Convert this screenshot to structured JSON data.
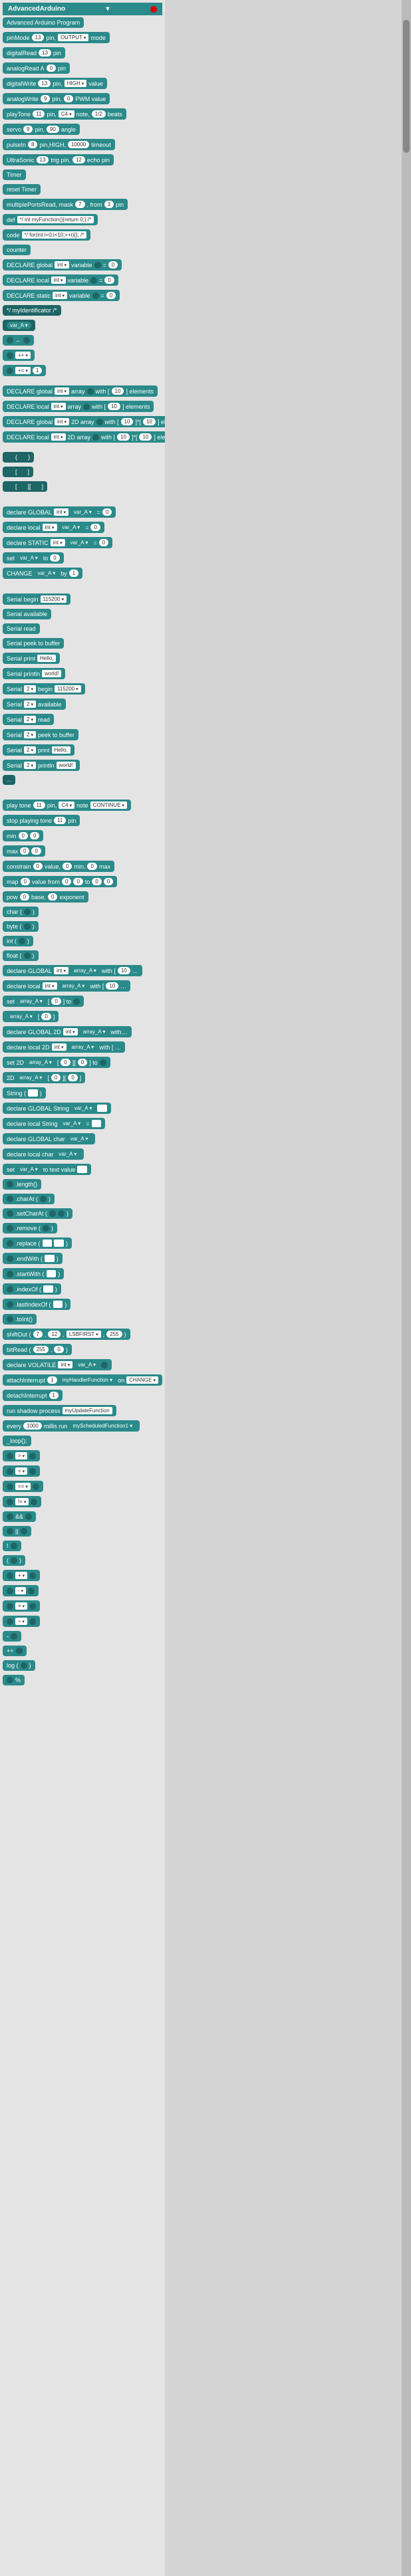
{
  "header": "AdvancedArduino",
  "blocks": [
    {
      "t": "Advanced Arduino Program"
    },
    {
      "parts": [
        "pinMode ",
        {
          "pill": "13"
        },
        " pin, ",
        {
          "drop": "OUTPUT"
        },
        " mode"
      ]
    },
    {
      "parts": [
        "digitalRead ",
        {
          "pill": "13"
        },
        " pin"
      ]
    },
    {
      "parts": [
        "analogRead A ",
        {
          "pill": "0"
        },
        " pin"
      ]
    },
    {
      "parts": [
        "digitalWrite ",
        {
          "pill": "13"
        },
        " pin, ",
        {
          "drop": "HIGH"
        },
        " value"
      ]
    },
    {
      "parts": [
        "analogWrite ",
        {
          "pill": "9"
        },
        " pin, ",
        {
          "pill": "0"
        },
        " PWM value"
      ]
    },
    {
      "parts": [
        "playTone ",
        {
          "pill": "11"
        },
        " pin, ",
        {
          "drop": "C4"
        },
        " note, ",
        {
          "pill": "1/2"
        },
        " beats"
      ]
    },
    {
      "parts": [
        "servo ",
        {
          "pill": "9"
        },
        " pin, ",
        {
          "pill": "90"
        },
        " angle"
      ]
    },
    {
      "parts": [
        "pulseIn ",
        {
          "pill": "8"
        },
        " pin,HIGH, ",
        {
          "pill": "10000"
        },
        " timeout"
      ]
    },
    {
      "parts": [
        "UltraSonic ",
        {
          "pill": "13"
        },
        " trig pin, ",
        {
          "pill": "12"
        },
        " echo pin"
      ]
    },
    {
      "t": "Timer"
    },
    {
      "t": "reset Timer"
    },
    {
      "parts": [
        "multiplePortsRead, mask ",
        {
          "pill": "7"
        },
        ", from ",
        {
          "pill": "3"
        },
        " pin"
      ]
    },
    {
      "parts": [
        "def ",
        {
          "rect": "*/ int myFunction(){return 0;} /*"
        }
      ]
    },
    {
      "parts": [
        "code ",
        {
          "rect": "*/ for(int i=0;i<10;++i){}; /*"
        }
      ]
    },
    {
      "t": "counter"
    },
    {
      "parts": [
        "DECLARE global ",
        {
          "drop": "int"
        },
        " variable ",
        {
          "hole": true
        },
        " = ",
        {
          "pill": "0"
        }
      ]
    },
    {
      "parts": [
        "DECLARE local ",
        {
          "drop": "int"
        },
        " variable ",
        {
          "hole": true
        },
        " = ",
        {
          "pill": "0"
        }
      ]
    },
    {
      "parts": [
        "DECLARE static ",
        {
          "drop": "int"
        },
        " variable ",
        {
          "hole": true
        },
        " = ",
        {
          "pill": "0"
        }
      ]
    },
    {
      "t": "*/ myIdentificator /*",
      "cls": "dark"
    },
    {
      "parts": [
        {
          "pilltg": "var_A"
        }
      ],
      "cls": "dark"
    },
    {
      "parts": [
        {
          "hole": true
        },
        " ← ",
        {
          "holerr": true
        }
      ]
    },
    {
      "parts": [
        {
          "hole": true
        },
        {
          "drop": "++"
        }
      ]
    },
    {
      "parts": [
        {
          "hole": true
        },
        {
          "drop": "+="
        },
        {
          "pill": "1"
        }
      ]
    },
    "sep",
    {
      "parts": [
        "DECLARE global ",
        {
          "drop": "int"
        },
        " array ",
        {
          "hole": true
        },
        " with [ ",
        {
          "pill": "10"
        },
        " ] elements"
      ]
    },
    {
      "parts": [
        "DECLARE local ",
        {
          "drop": "int"
        },
        " array ",
        {
          "hole": true
        },
        " with [ ",
        {
          "pill": "10"
        },
        " ] elements"
      ]
    },
    {
      "parts": [
        "DECLARE global ",
        {
          "drop": "int"
        },
        " 2D array ",
        {
          "hole": true
        },
        " with [ ",
        {
          "pill": "10"
        },
        " ]*[ ",
        {
          "pill": "10"
        },
        " ] elements"
      ]
    },
    {
      "parts": [
        "DECLARE local ",
        {
          "drop": "int"
        },
        " 2D array ",
        {
          "hole": true
        },
        " with [ ",
        {
          "pill": "10"
        },
        " ]*[ ",
        {
          "pill": "10"
        },
        " ] elements"
      ]
    },
    "sep",
    {
      "parts": [
        {
          "hole": true
        },
        " (",
        {
          "holerr": true
        },
        ") "
      ],
      "cls": "dark"
    },
    {
      "parts": [
        {
          "hole": true
        },
        " [",
        {
          "holerr": true
        },
        "] "
      ],
      "cls": "dark"
    },
    {
      "parts": [
        {
          "hole": true
        },
        " [",
        {
          "holerr": true
        },
        "][",
        {
          "holerr": true
        },
        "] "
      ],
      "cls": "dark"
    },
    "sep2",
    {
      "parts": [
        "declare GLOBAL ",
        {
          "drop": "int"
        },
        {
          "pilltg": "var_A"
        },
        " = ",
        {
          "pill": "0"
        }
      ]
    },
    {
      "parts": [
        "declare local ",
        {
          "drop": "int"
        },
        {
          "pilltg": "var_A"
        },
        " = ",
        {
          "pill": "0"
        }
      ]
    },
    {
      "parts": [
        "declare STATIC ",
        {
          "drop": "int"
        },
        {
          "pilltg": "var_A"
        },
        " = ",
        {
          "pill": "0"
        }
      ]
    },
    {
      "parts": [
        "set ",
        {
          "pilltg": "var_A"
        },
        " to ",
        {
          "pill": "0"
        }
      ]
    },
    {
      "parts": [
        "CHANGE ",
        {
          "pilltg": "var_A"
        },
        " by ",
        {
          "pill": "1"
        }
      ]
    },
    "sep2",
    {
      "parts": [
        "Serial begin ",
        {
          "drop": "115200"
        }
      ]
    },
    {
      "t": "Serial available"
    },
    {
      "t": "Serial read"
    },
    {
      "t": "Serial peek to buffer"
    },
    {
      "parts": [
        "Serial print ",
        {
          "rect": "Hello,"
        }
      ]
    },
    {
      "parts": [
        "Serial println ",
        {
          "rect": "world!"
        }
      ]
    },
    {
      "parts": [
        "Serial ",
        {
          "drop": "2"
        },
        " begin ",
        {
          "drop": "115200"
        }
      ]
    },
    {
      "parts": [
        "Serial ",
        {
          "drop": "2"
        },
        " available"
      ]
    },
    {
      "parts": [
        "Serial ",
        {
          "drop": "2"
        },
        " read"
      ]
    },
    {
      "parts": [
        "Serial ",
        {
          "drop": "2"
        },
        " peek to buffer"
      ]
    },
    {
      "parts": [
        "Serial ",
        {
          "drop": "2"
        },
        " print ",
        {
          "rect": "Hello,"
        }
      ]
    },
    {
      "parts": [
        "Serial ",
        {
          "drop": "2"
        },
        " println ",
        {
          "rect": "world!"
        }
      ]
    },
    {
      "t": "...",
      "cls": "dark small"
    },
    "sep2",
    {
      "parts": [
        "play tone ",
        {
          "pill": "11"
        },
        " pin, ",
        {
          "drop": "C4"
        },
        " note ",
        {
          "drop": "CONTINUE"
        }
      ]
    },
    {
      "parts": [
        "stop playing tone ",
        {
          "pill": "11"
        },
        " pin"
      ]
    },
    {
      "parts": [
        "min ",
        {
          "pill": "0"
        },
        {
          "pill": "0"
        }
      ]
    },
    {
      "parts": [
        "max ",
        {
          "pill": "0"
        },
        {
          "pill": "0"
        }
      ]
    },
    {
      "parts": [
        "constrain ",
        {
          "pill": "0"
        },
        " value, ",
        {
          "pill": "0"
        },
        " min, ",
        {
          "pill": "0"
        },
        " max"
      ]
    },
    {
      "parts": [
        "map ",
        {
          "pill": "0"
        },
        " value from ",
        {
          "pill": "0"
        },
        {
          "pill": "0"
        },
        " to ",
        {
          "pill": "0"
        },
        {
          "pill": "0"
        }
      ]
    },
    {
      "parts": [
        "pow ",
        {
          "pill": "0"
        },
        " base, ",
        {
          "pill": "0"
        },
        " exponent"
      ]
    },
    {
      "parts": [
        "char ( ",
        {
          "holerr": true
        },
        " )"
      ]
    },
    {
      "parts": [
        "byte ( ",
        {
          "holerr": true
        },
        " )"
      ]
    },
    {
      "parts": [
        "int ( ",
        {
          "holerr": true
        },
        " )"
      ]
    },
    {
      "parts": [
        "float ( ",
        {
          "holerr": true
        },
        " )"
      ]
    },
    {
      "parts": [
        "declare GLOBAL ",
        {
          "drop": "int"
        },
        {
          "pilltg": "array_A"
        },
        " with [ ",
        {
          "pill": "10"
        },
        " …"
      ]
    },
    {
      "parts": [
        "declare local ",
        {
          "drop": "int"
        },
        {
          "pilltg": "array_A"
        },
        " with [ ",
        {
          "pill": "10"
        },
        " …"
      ]
    },
    {
      "parts": [
        "set ",
        {
          "pilltg": "array_A"
        },
        " [ ",
        {
          "pill": "0"
        },
        " ] to ",
        {
          "holerr": true
        }
      ]
    },
    {
      "parts": [
        {
          "pilltg": "array_A"
        },
        " [ ",
        {
          "pill": "0"
        },
        " ]"
      ]
    },
    {
      "parts": [
        "declare GLOBAL 2D ",
        {
          "drop": "int"
        },
        {
          "pilltg": "array_A"
        },
        " with…"
      ]
    },
    {
      "parts": [
        "declare local 2D ",
        {
          "drop": "int"
        },
        {
          "pilltg": "array_A"
        },
        " with [ …"
      ]
    },
    {
      "parts": [
        "set 2D ",
        {
          "pilltg": "array_A"
        },
        " [ ",
        {
          "pill": "0"
        },
        " ][ ",
        {
          "pill": "0"
        },
        " ] to ",
        {
          "holerr": true
        }
      ]
    },
    {
      "parts": [
        "2D ",
        {
          "pilltg": "array_A"
        },
        " [ ",
        {
          "pill": "0"
        },
        " ][ ",
        {
          "pill": "0"
        },
        " ]"
      ]
    },
    {
      "parts": [
        "String ( ",
        {
          "rectw": true
        },
        " )"
      ]
    },
    {
      "parts": [
        "declare GLOBAL String ",
        {
          "pilltg": "var_A"
        },
        " ",
        {
          "rectw": true
        }
      ]
    },
    {
      "parts": [
        "declare local String ",
        {
          "pilltg": "var_A"
        },
        " = ",
        {
          "rectw": true
        }
      ]
    },
    {
      "parts": [
        "declare GLOBAL char ",
        {
          "pilltg": "var_A"
        }
      ]
    },
    {
      "parts": [
        "declare local char ",
        {
          "pilltg": "var_A"
        }
      ]
    },
    {
      "parts": [
        "set ",
        {
          "pilltg": "var_A"
        },
        " to text value ",
        {
          "rectw": true
        }
      ]
    },
    {
      "parts": [
        {
          "holerr": true
        },
        ".length()"
      ]
    },
    {
      "parts": [
        {
          "holerr": true
        },
        ".charAt ( ",
        {
          "holerr": true
        },
        " )"
      ]
    },
    {
      "parts": [
        {
          "holerr": true
        },
        ".setCharAt ( ",
        {
          "holerr": true
        },
        {
          "holerr": true
        },
        " )"
      ]
    },
    {
      "parts": [
        {
          "holerr": true
        },
        ".remove ( ",
        {
          "holerr": true
        },
        " )"
      ]
    },
    {
      "parts": [
        {
          "holerr": true
        },
        ".replace ( ",
        {
          "rectw": true
        },
        {
          "rectw": true
        },
        " )"
      ]
    },
    {
      "parts": [
        {
          "holerr": true
        },
        ".endWith ( ",
        {
          "rectw": true
        },
        " )"
      ]
    },
    {
      "parts": [
        {
          "holerr": true
        },
        ".startWith ( ",
        {
          "rectw": true
        },
        " )"
      ]
    },
    {
      "parts": [
        {
          "holerr": true
        },
        ".indexOf ( ",
        {
          "rectw": true
        },
        " )"
      ]
    },
    {
      "parts": [
        {
          "holerr": true
        },
        ".lastIndexOf ( ",
        {
          "rectw": true
        },
        " )"
      ]
    },
    {
      "parts": [
        {
          "holerr": true
        },
        ".toInt()"
      ]
    },
    {
      "parts": [
        "shiftOut ( ",
        {
          "pill": "7"
        },
        ", ",
        {
          "pill": "12"
        },
        ", ",
        {
          "drop": "LSBFIRST"
        },
        ", ",
        {
          "pill": "255"
        },
        " )"
      ]
    },
    {
      "parts": [
        "bitRead ( ",
        {
          "pill": "255"
        },
        ", ",
        {
          "pill": "0"
        },
        " )"
      ]
    },
    {
      "parts": [
        "declare VOLATILE ",
        {
          "drop": "int"
        },
        {
          "pilltg": "var_A"
        },
        " ",
        {
          "holerr": true
        }
      ]
    },
    {
      "parts": [
        "attachInterrupt ",
        {
          "pill": "1"
        },
        {
          "pilltg": "myHandlerFunction"
        },
        " on ",
        {
          "drop": "CHANGE"
        }
      ]
    },
    {
      "parts": [
        "detachInterrupt ",
        {
          "pill": "1"
        }
      ]
    },
    {
      "parts": [
        "run shadow process ",
        {
          "rect": "myUpdateFunction"
        }
      ]
    },
    {
      "parts": [
        "every ",
        {
          "pill": "1000"
        },
        " millis run ",
        {
          "pilltg": "myScheduledFunction1"
        }
      ]
    },
    {
      "t": "_loop();"
    },
    {
      "parts": [
        {
          "holerr": true
        },
        {
          "drop": ">"
        },
        {
          "holerr": true
        }
      ]
    },
    {
      "parts": [
        {
          "holerr": true
        },
        {
          "drop": "<"
        },
        {
          "holerr": true
        }
      ]
    },
    {
      "parts": [
        {
          "holerr": true
        },
        {
          "drop": "=="
        },
        {
          "holerr": true
        }
      ]
    },
    {
      "parts": [
        {
          "holerr": true
        },
        {
          "drop": "!="
        },
        {
          "holerr": true
        }
      ]
    },
    {
      "parts": [
        {
          "hole": true
        },
        " && ",
        {
          "hole": true
        }
      ]
    },
    {
      "parts": [
        {
          "hole": true
        },
        " || ",
        {
          "hole": true
        }
      ]
    },
    {
      "parts": [
        "! ",
        {
          "hole": true
        }
      ]
    },
    {
      "parts": [
        "( ",
        {
          "holerr": true
        },
        " )"
      ]
    },
    {
      "parts": [
        {
          "holerr": true
        },
        {
          "drop": "+"
        },
        {
          "holerr": true
        }
      ]
    },
    {
      "parts": [
        {
          "holerr": true
        },
        {
          "drop": "-"
        },
        {
          "holerr": true
        }
      ]
    },
    {
      "parts": [
        {
          "holerr": true
        },
        {
          "drop": "×"
        },
        {
          "holerr": true
        }
      ]
    },
    {
      "parts": [
        {
          "holerr": true
        },
        {
          "drop": "÷"
        },
        {
          "holerr": true
        }
      ]
    },
    {
      "parts": [
        "- ",
        {
          "holerr": true
        }
      ]
    },
    {
      "parts": [
        "++ ",
        {
          "holerr": true
        }
      ]
    },
    {
      "parts": [
        "log ( ",
        {
          "holerr": true
        },
        " )"
      ]
    },
    {
      "parts": [
        {
          "holerr": true
        },
        " %"
      ]
    }
  ]
}
